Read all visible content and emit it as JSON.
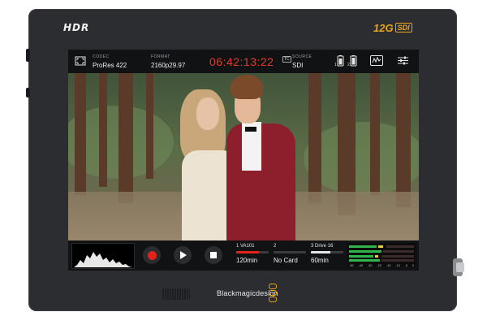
{
  "device": {
    "hdr_label": "HDR",
    "sdi_speed": "12G",
    "sdi_label": "SDI",
    "brand_name": "Blackmagicdesign",
    "accent_color": "#e8a51c",
    "body_color": "#2b2d31"
  },
  "topbar": {
    "codec_label": "CODEC",
    "codec_value": "ProRes 422",
    "format_label": "FORMAT",
    "format_value": "2160p29.97",
    "timecode": "06:42:13:22",
    "timecode_color": "#e23b2e",
    "hd_badge": "TC",
    "source_label": "SOURCE",
    "source_value": "SDI",
    "icons": [
      "frame-guides-icon",
      "battery-1-icon",
      "battery-2-icon",
      "scopes-icon",
      "settings-sliders-icon"
    ],
    "battery_nums": [
      "1",
      "2"
    ]
  },
  "bottombar": {
    "slots": [
      {
        "name": "1  VA101",
        "time": "120min",
        "fill_fraction": 0.7,
        "color": "#e2231a"
      },
      {
        "name": "2",
        "time": "No Card",
        "fill_fraction": 0,
        "color": "#888888"
      },
      {
        "name": "3  Drive 16",
        "time": "60min",
        "fill_fraction": 0.6,
        "color": "#e6e6e6"
      }
    ],
    "audio_scale": [
      "-50",
      "-40",
      "-30",
      "-20",
      "-15",
      "-10",
      "-5",
      "0"
    ],
    "icons": [
      "histogram-icon",
      "record-icon",
      "play-icon",
      "stop-icon",
      "audio-meter-icon"
    ]
  }
}
